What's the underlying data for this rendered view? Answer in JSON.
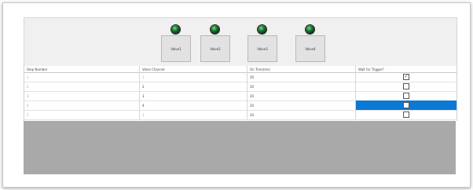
{
  "valves": [
    {
      "label": "Valve1"
    },
    {
      "label": "Valve2"
    },
    {
      "label": "Valve3"
    },
    {
      "label": "Valve4"
    }
  ],
  "table": {
    "headers": [
      "Step Number",
      "Valve Channel",
      "On Time(ms)",
      "Wait for Trigger?"
    ],
    "rows": [
      {
        "step": "1",
        "channel": "1",
        "time": "20",
        "wait": true
      },
      {
        "step": "2",
        "channel": "2",
        "time": "20",
        "wait": false
      },
      {
        "step": "3",
        "channel": "3",
        "time": "20",
        "wait": false
      },
      {
        "step": "4",
        "channel": "4",
        "time": "20",
        "wait": false
      },
      {
        "step": "5",
        "channel": "1",
        "time": "20",
        "wait": false
      }
    ]
  },
  "colors": {
    "selection": "#0b78d6",
    "led_on": "#1f7a36",
    "empty_area": "#a9a9a9"
  }
}
